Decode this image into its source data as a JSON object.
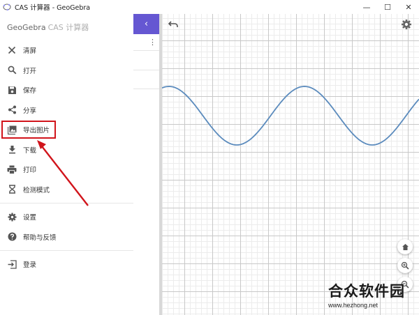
{
  "window": {
    "title": "CAS 计算器 - GeoGebra",
    "minimize_glyph": "—",
    "maximize_glyph": "☐",
    "close_glyph": "✕"
  },
  "sidebar": {
    "brand": "GeoGebra",
    "brand_sub": "CAS 计算器",
    "items": [
      {
        "label": "清屏",
        "icon": "close-icon"
      },
      {
        "label": "打开",
        "icon": "search-icon"
      },
      {
        "label": "保存",
        "icon": "save-icon"
      },
      {
        "label": "分享",
        "icon": "share-icon"
      },
      {
        "label": "导出图片",
        "icon": "image-icon",
        "highlighted": true
      },
      {
        "label": "下载",
        "icon": "download-icon"
      },
      {
        "label": "打印",
        "icon": "print-icon"
      },
      {
        "label": "检测模式",
        "icon": "hourglass-icon"
      },
      {
        "label": "设置",
        "icon": "gear-icon"
      },
      {
        "label": "帮助与反馈",
        "icon": "help-icon"
      },
      {
        "label": "登录",
        "icon": "sign-in-icon"
      }
    ]
  },
  "algebra_panel": {
    "collapse_glyph": "‹",
    "more_glyph": "⋮"
  },
  "graphics": {
    "curve_color": "#5b8bbd",
    "grid_major_color": "#c8c8c8",
    "grid_minor_color": "#ececec"
  },
  "annotation": {
    "color": "#d1141b"
  },
  "watermark": {
    "text": "合众软件园",
    "url": "www.hezhong.net"
  },
  "colors": {
    "accent": "#6557d2",
    "icon": "#555555"
  }
}
